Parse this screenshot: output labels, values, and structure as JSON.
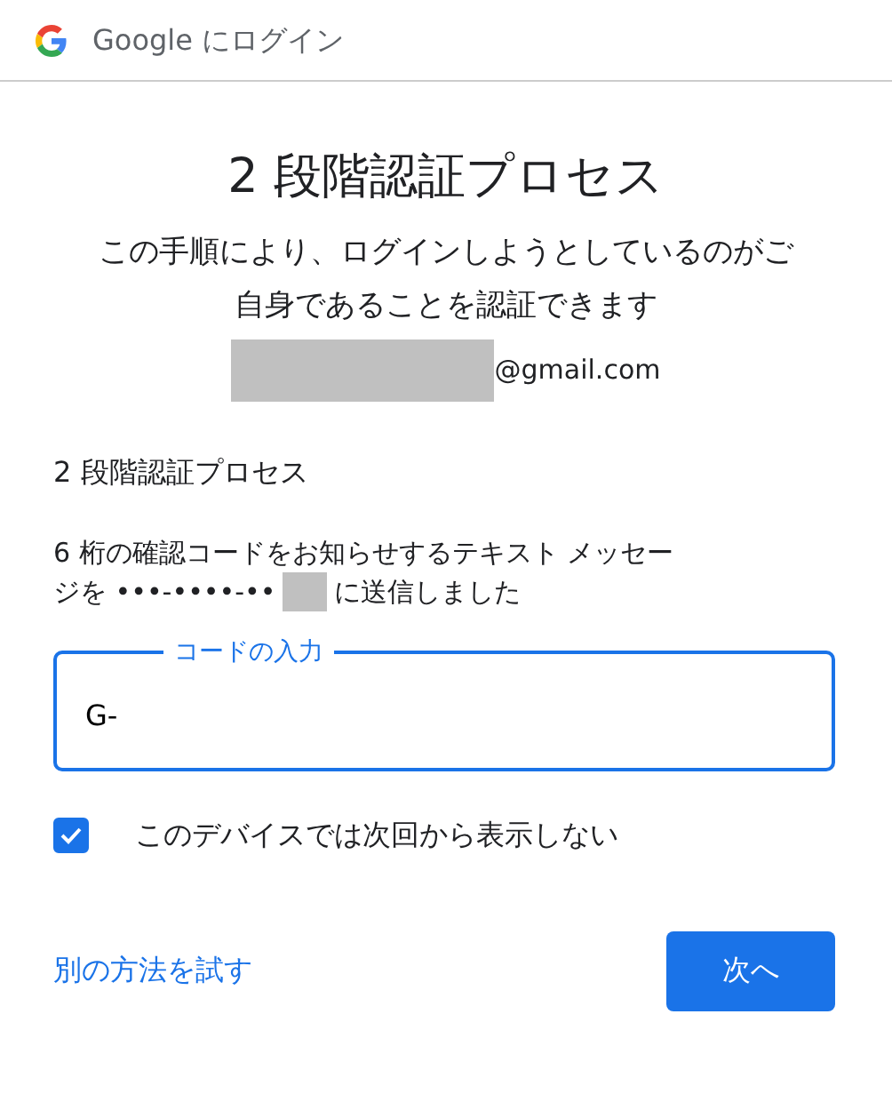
{
  "header": {
    "title": "Google にログイン"
  },
  "heading": "2 段階認証プロセス",
  "subtitle": "この手順により、ログインしようとしているのがご自身であることを認証できます",
  "account": {
    "email_suffix": "@gmail.com"
  },
  "section_title": "2 段階認証プロセス",
  "message": {
    "line_1": "6 桁の確認コードをお知らせするテキスト メッセー",
    "line_2_start": "ジを •••-••••-••",
    "line_2_end": "に送信しました"
  },
  "code_field": {
    "label": "コードの入力",
    "value": "G-",
    "focused": true
  },
  "remember": {
    "label": "このデバイスでは次回から表示しない",
    "checked": true
  },
  "other_method_link": "別の方法を試す",
  "next_button": "次へ"
}
